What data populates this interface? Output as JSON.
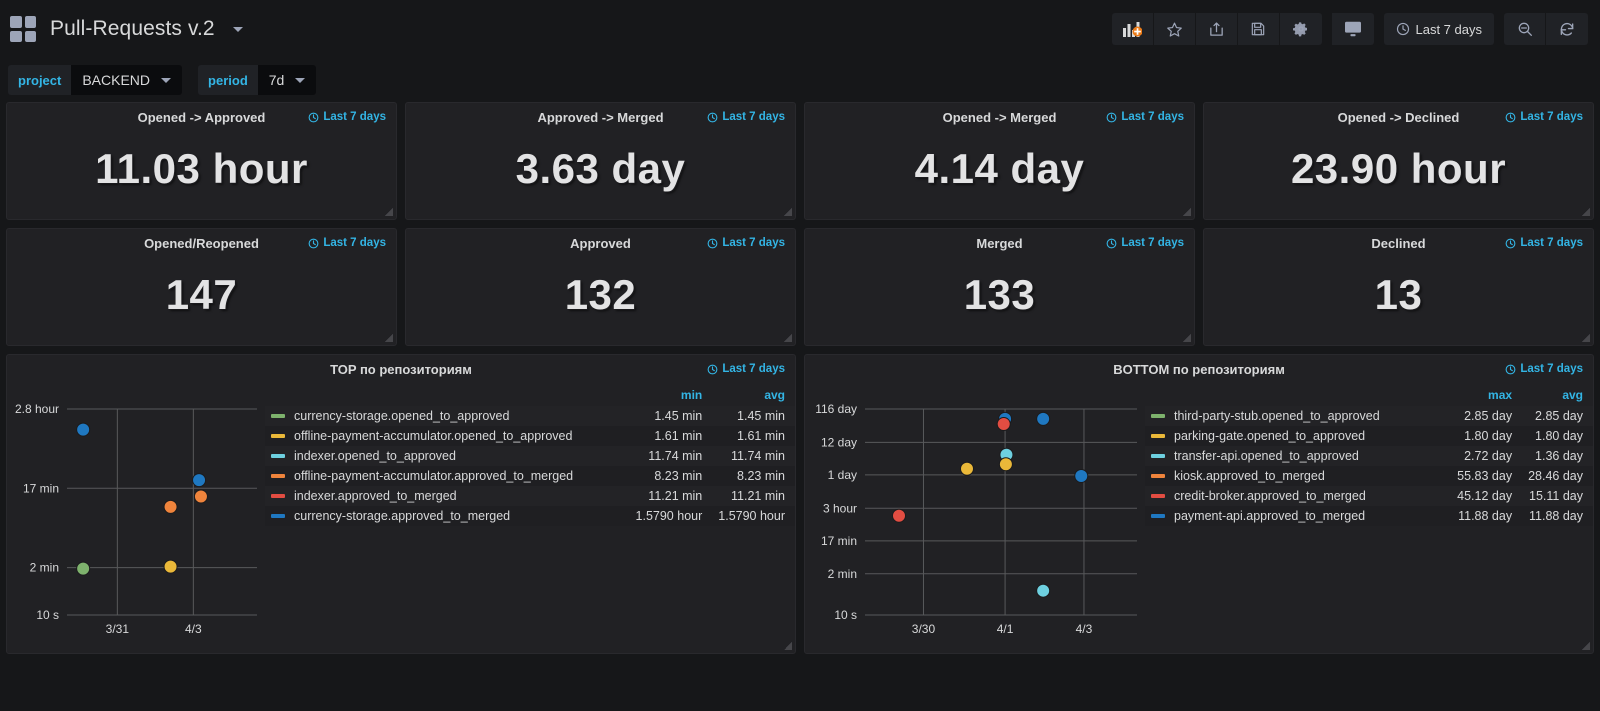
{
  "navbar": {
    "title": "Pull-Requests v.2",
    "logo_icon": "grid-logo-icon",
    "caret_icon": "chevron-down-icon",
    "buttons": [
      {
        "name": "add-panel-button",
        "icon": "add-panel-icon",
        "label": ""
      },
      {
        "name": "star-dashboard-button",
        "icon": "star-icon",
        "label": ""
      },
      {
        "name": "share-dashboard-button",
        "icon": "share-icon",
        "label": ""
      },
      {
        "name": "save-dashboard-button",
        "icon": "save-floppy-icon",
        "label": ""
      },
      {
        "name": "dashboard-settings-button",
        "icon": "gear-icon",
        "label": ""
      }
    ],
    "tv_button": {
      "name": "tv-mode-button",
      "icon": "monitor-icon"
    },
    "time_picker": {
      "icon": "clock-icon",
      "label": "Last 7 days"
    },
    "zoom_out_button": {
      "name": "zoom-out-button",
      "icon": "search-minus-icon"
    },
    "refresh_button": {
      "name": "refresh-button",
      "icon": "refresh-icon"
    }
  },
  "variables": [
    {
      "name": "project",
      "label": "project",
      "value": "BACKEND"
    },
    {
      "name": "period",
      "label": "period",
      "value": "7d"
    }
  ],
  "time_range_label": "Last 7 days",
  "stats_row_1": [
    {
      "title": "Opened -> Approved",
      "value": "11.03 hour",
      "time_range": "Last 7 days"
    },
    {
      "title": "Approved -> Merged",
      "value": "3.63 day",
      "time_range": "Last 7 days"
    },
    {
      "title": "Opened -> Merged",
      "value": "4.14 day",
      "time_range": "Last 7 days"
    },
    {
      "title": "Opened -> Declined",
      "value": "23.90 hour",
      "time_range": "Last 7 days"
    }
  ],
  "stats_row_2": [
    {
      "title": "Opened/Reopened",
      "value": "147",
      "time_range": "Last 7 days"
    },
    {
      "title": "Approved",
      "value": "132",
      "time_range": "Last 7 days"
    },
    {
      "title": "Merged",
      "value": "133",
      "time_range": "Last 7 days"
    },
    {
      "title": "Declined",
      "value": "13",
      "time_range": "Last 7 days"
    }
  ],
  "top_panel": {
    "title": "TOP по репозиториям",
    "time_range": "Last 7 days",
    "legend_headers": {
      "series": "",
      "col1": "min",
      "col2": "avg"
    },
    "legend_rows": [
      {
        "color": "#7eb26d",
        "series": "currency-storage.opened_to_approved",
        "col1": "1.45 min",
        "col2": "1.45 min"
      },
      {
        "color": "#eab839",
        "series": "offline-payment-accumulator.opened_to_approved",
        "col1": "1.61 min",
        "col2": "1.61 min"
      },
      {
        "color": "#6ed0e0",
        "series": "indexer.opened_to_approved",
        "col1": "11.74 min",
        "col2": "11.74 min"
      },
      {
        "color": "#ef843c",
        "series": "offline-payment-accumulator.approved_to_merged",
        "col1": "8.23 min",
        "col2": "8.23 min"
      },
      {
        "color": "#e24d42",
        "series": "indexer.approved_to_merged",
        "col1": "11.21 min",
        "col2": "11.21 min"
      },
      {
        "color": "#1f78c1",
        "series": "currency-storage.approved_to_merged",
        "col1": "1.5790 hour",
        "col2": "1.5790 hour"
      }
    ]
  },
  "bottom_panel": {
    "title": "BOTTOM по репозиториям",
    "time_range": "Last 7 days",
    "legend_headers": {
      "series": "",
      "col1": "max",
      "col2": "avg"
    },
    "legend_rows": [
      {
        "color": "#7eb26d",
        "series": "third-party-stub.opened_to_approved",
        "col1": "2.85 day",
        "col2": "2.85 day"
      },
      {
        "color": "#eab839",
        "series": "parking-gate.opened_to_approved",
        "col1": "1.80 day",
        "col2": "1.80 day"
      },
      {
        "color": "#6ed0e0",
        "series": "transfer-api.opened_to_approved",
        "col1": "2.72 day",
        "col2": "1.36 day"
      },
      {
        "color": "#ef843c",
        "series": "kiosk.approved_to_merged",
        "col1": "55.83 day",
        "col2": "28.46 day"
      },
      {
        "color": "#e24d42",
        "series": "credit-broker.approved_to_merged",
        "col1": "45.12 day",
        "col2": "15.11 day"
      },
      {
        "color": "#1f78c1",
        "series": "payment-api.approved_to_merged",
        "col1": "11.88 day",
        "col2": "11.88 day"
      }
    ]
  },
  "chart_data": [
    {
      "id": "top-chart",
      "type": "scatter",
      "title": "TOP по репозиториям",
      "xlabel": "",
      "ylabel": "",
      "grid": true,
      "legend_position": "right",
      "y_ticks": [
        "2.8 hour",
        "17 min",
        "2 min",
        "10 s"
      ],
      "y_tick_pos": [
        0.0,
        0.385,
        0.77,
        1.0
      ],
      "x_ticks": [
        "3/31",
        "4/3"
      ],
      "x_tick_pos": [
        0.265,
        0.665
      ],
      "points": [
        {
          "series": "currency-storage.approved_to_merged",
          "color": "#1f78c1",
          "x": 0.085,
          "y": 0.1,
          "label": "1.5790 hour"
        },
        {
          "series": "indexer.approved_to_merged",
          "color": "#1f78c1",
          "x": 0.695,
          "y": 0.345,
          "label": "11.21 min"
        },
        {
          "series": "offline-payment-accumulator.approved_to_merged",
          "color": "#ef843c",
          "x": 0.705,
          "y": 0.425,
          "label": "8.23 min"
        },
        {
          "series": "offline-payment-accumulator.opened_to_approved",
          "color": "#ef843c",
          "x": 0.545,
          "y": 0.475,
          "label": "1.61 min"
        },
        {
          "series": "currency-storage.opened_to_approved",
          "color": "#7eb26d",
          "x": 0.085,
          "y": 0.775,
          "label": "1.45 min"
        },
        {
          "series": "indexer.opened_to_approved",
          "color": "#eab839",
          "x": 0.545,
          "y": 0.765,
          "label": "11.74 min"
        }
      ]
    },
    {
      "id": "bottom-chart",
      "type": "scatter",
      "title": "BOTTOM по репозиториям",
      "xlabel": "",
      "ylabel": "",
      "grid": true,
      "legend_position": "right",
      "y_ticks": [
        "116 day",
        "12 day",
        "1 day",
        "3 hour",
        "17 min",
        "2 min",
        "10 s"
      ],
      "y_tick_pos": [
        0.0,
        0.162,
        0.32,
        0.482,
        0.64,
        0.8,
        1.0
      ],
      "x_ticks": [
        "3/30",
        "4/1",
        "4/3"
      ],
      "x_tick_pos": [
        0.215,
        0.515,
        0.805
      ],
      "points": [
        {
          "series": "payment-api.approved_to_merged",
          "color": "#1f78c1",
          "x": 0.515,
          "y": 0.048,
          "label": "11.88 day"
        },
        {
          "series": "credit-broker.approved_to_merged",
          "color": "#e24d42",
          "x": 0.51,
          "y": 0.073,
          "label": "45.12 day"
        },
        {
          "series": "kiosk.approved_to_merged",
          "color": "#1f78c1",
          "x": 0.655,
          "y": 0.048,
          "label": "55.83 day"
        },
        {
          "series": "transfer-api.opened_to_approved",
          "color": "#6ed0e0",
          "x": 0.52,
          "y": 0.222,
          "label": "2.72 day"
        },
        {
          "series": "parking-gate.opened_to_approved",
          "color": "#eab839",
          "x": 0.518,
          "y": 0.268,
          "label": "1.80 day"
        },
        {
          "series": "third-party-stub.opened_to_approved",
          "color": "#eab839",
          "x": 0.375,
          "y": 0.29,
          "label": "2.85 day"
        },
        {
          "series": "payment-api.approved_to_merged",
          "color": "#1f78c1",
          "x": 0.795,
          "y": 0.325,
          "label": "1 day"
        },
        {
          "series": "credit-broker.approved_to_merged",
          "color": "#e24d42",
          "x": 0.125,
          "y": 0.518,
          "label": "3 hour"
        },
        {
          "series": "transfer-api.opened_to_approved",
          "color": "#6ed0e0",
          "x": 0.655,
          "y": 0.882,
          "label": "2 min"
        }
      ]
    }
  ]
}
